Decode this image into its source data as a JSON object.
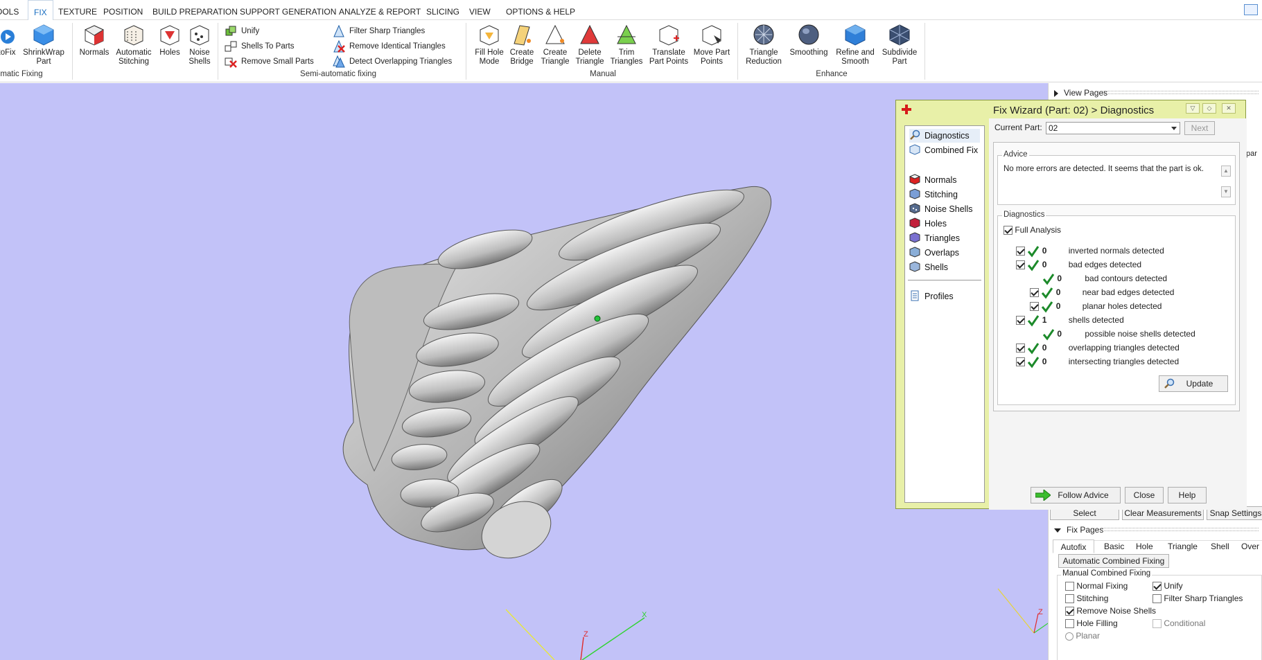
{
  "menu": {
    "items": [
      "OOLS",
      "FIX",
      "TEXTURE",
      "POSITION",
      "BUILD PREPARATION",
      "SUPPORT GENERATION",
      "ANALYZE & REPORT",
      "SLICING",
      "VIEW",
      "OPTIONS & HELP"
    ],
    "active": "FIX"
  },
  "ribbon": {
    "autofix": {
      "label": "toFix"
    },
    "shrinkwrap": {
      "label1": "ShrinkWrap",
      "label2": "Part"
    },
    "automatic_group": "matic Fixing",
    "normals": {
      "label": "Normals"
    },
    "stitching": {
      "label1": "Automatic",
      "label2": "Stitching"
    },
    "holes": {
      "label": "Holes"
    },
    "noise": {
      "label1": "Noise",
      "label2": "Shells"
    },
    "unify": "Unify",
    "shells_to_parts": "Shells To Parts",
    "remove_small": "Remove Small Parts",
    "filter_sharp": "Filter Sharp Triangles",
    "remove_identical": "Remove Identical Triangles",
    "detect_overlap": "Detect Overlapping Triangles",
    "semi_group": "Semi-automatic fixing",
    "fill_hole": {
      "label1": "Fill Hole",
      "label2": "Mode"
    },
    "create_bridge": {
      "label1": "Create",
      "label2": "Bridge"
    },
    "create_triangle": {
      "label1": "Create",
      "label2": "Triangle"
    },
    "delete_triangle": {
      "label1": "Delete",
      "label2": "Triangle"
    },
    "trim_triangles": {
      "label1": "Trim",
      "label2": "Triangles"
    },
    "translate_points": {
      "label1": "Translate",
      "label2": "Part Points"
    },
    "move_points": {
      "label1": "Move Part",
      "label2": "Points"
    },
    "manual_group": "Manual",
    "tri_reduction": {
      "label1": "Triangle",
      "label2": "Reduction"
    },
    "smoothing": {
      "label": "Smoothing"
    },
    "refine_smooth": {
      "label1": "Refine and",
      "label2": "Smooth"
    },
    "subdivide": {
      "label1": "Subdivide",
      "label2": "Part"
    },
    "enhance_group": "Enhance"
  },
  "viewport": {
    "bg": "#c2c2f8",
    "axis_x": "X",
    "axis_z": "Z"
  },
  "wizard": {
    "title": "Fix Wizard (Part: 02) > Diagnostics",
    "nav": [
      "Diagnostics",
      "Combined Fix",
      "Normals",
      "Stitching",
      "Noise Shells",
      "Holes",
      "Triangles",
      "Overlaps",
      "Shells",
      "Profiles"
    ],
    "current_part_label": "Current Part:",
    "current_part_value": "02",
    "next_label": "Next",
    "advice_legend": "Advice",
    "advice_text": "No more errors are detected. It seems that the part is ok.",
    "diag_legend": "Diagnostics",
    "full_analysis": "Full Analysis",
    "rows": [
      {
        "count": "0",
        "label": "inverted normals detected"
      },
      {
        "count": "0",
        "label": "bad edges detected"
      },
      {
        "count": "0",
        "label": "bad contours detected"
      },
      {
        "count": "0",
        "label": "near bad edges detected"
      },
      {
        "count": "0",
        "label": "planar holes detected"
      },
      {
        "count": "1",
        "label": "shells detected"
      },
      {
        "count": "0",
        "label": "possible noise shells detected"
      },
      {
        "count": "0",
        "label": "overlapping triangles detected"
      },
      {
        "count": "0",
        "label": "intersecting triangles detected"
      }
    ],
    "update_label": "Update",
    "follow_advice_label": "Follow Advice",
    "close_label": "Close",
    "help_label": "Help"
  },
  "panel": {
    "view_pages": "View Pages",
    "partial_text": "par",
    "select": "Select",
    "clear_measurements": "Clear Measurements",
    "snap_settings": "Snap Settings",
    "fix_pages": "Fix Pages",
    "tabs": [
      "Autofix",
      "Basic",
      "Hole",
      "Triangle",
      "Shell",
      "Over"
    ],
    "automatic_combined": "Automatic Combined Fixing",
    "manual_combined": "Manual Combined Fixing",
    "normal_fixing": "Normal Fixing",
    "unify": "Unify",
    "stitching": "Stitching",
    "filter_sharp": "Filter Sharp Triangles",
    "remove_noise": "Remove Noise Shells",
    "hole_filling": "Hole Filling",
    "conditional": "Conditional",
    "planar": "Planar"
  },
  "colors": {
    "accent": "#1a6fc2",
    "wizard_bg": "#e8f0a8",
    "check_green": "#1c8a2a"
  }
}
